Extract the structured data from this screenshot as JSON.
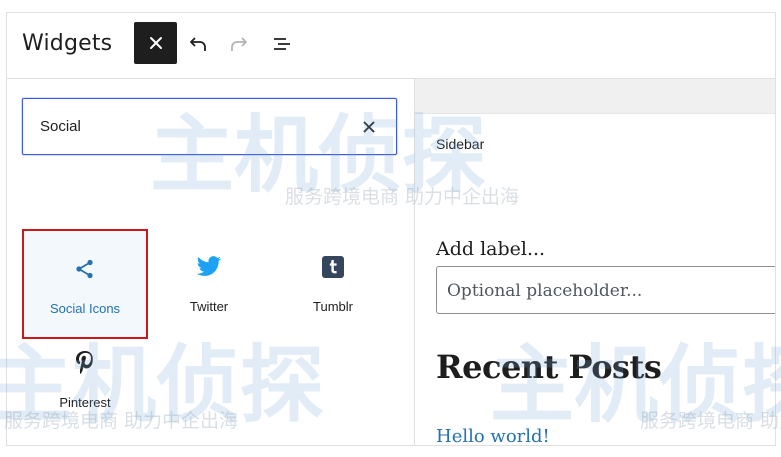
{
  "header": {
    "title": "Widgets",
    "close_icon": "close-icon",
    "undo_icon": "undo-icon",
    "redo_icon": "redo-icon",
    "list_view_icon": "list-view-icon"
  },
  "inserter": {
    "search": {
      "value": "Social",
      "clear_icon": "close-icon"
    },
    "blocks": [
      {
        "label": "Social Icons",
        "icon": "share-icon",
        "selected": true
      },
      {
        "label": "Twitter",
        "icon": "twitter-icon",
        "selected": false
      },
      {
        "label": "Tumblr",
        "icon": "tumblr-icon",
        "selected": false
      },
      {
        "label": "Pinterest",
        "icon": "pinterest-icon",
        "selected": false
      }
    ]
  },
  "canvas": {
    "area_label": "Sidebar",
    "search_widget": {
      "add_label": "Add label...",
      "placeholder": "Optional placeholder..."
    },
    "recent_posts": {
      "heading": "Recent Posts",
      "items": [
        "Hello world!"
      ]
    }
  },
  "watermark": {
    "main": "主机侦探",
    "sub": "服务跨境电商 助力中企出海"
  },
  "colors": {
    "accent": "#3858e9",
    "selected_border": "#cc1818",
    "link": "#2271b1",
    "twitter": "#1da1f2",
    "dark": "#1e1e1e"
  }
}
